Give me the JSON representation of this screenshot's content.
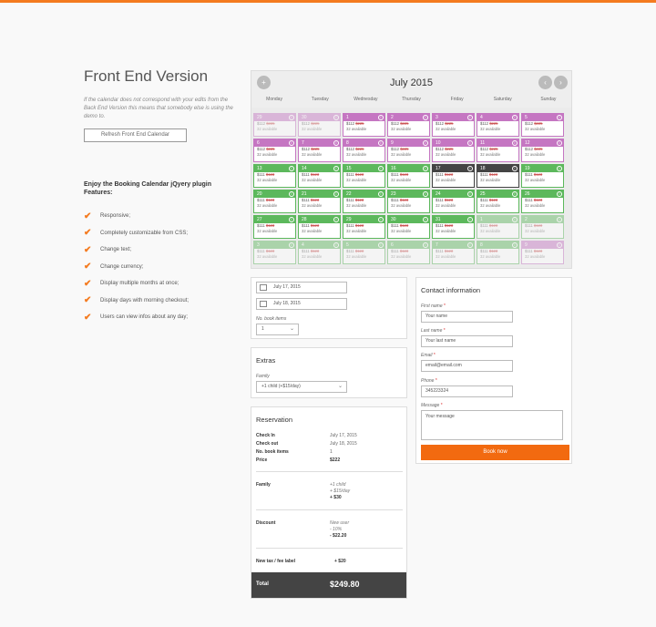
{
  "colors": {
    "accent": "#f47b20",
    "book_button": "#f26a10",
    "booked_purple": "#c576c2",
    "available_green": "#5cb85c",
    "selected_dark": "#444444"
  },
  "left": {
    "title": "Front End Version",
    "note": "If the calendar does not correspond with your edits from the Back End Version this means that somebody else is using the demo to.",
    "refresh_label": "Refresh Front End Calendar",
    "enjoy_heading": "Enjoy the Booking Calendar jQyery plugin Features:",
    "features": [
      "Responsive;",
      "Completely customizable from CSS;",
      "Change text;",
      "Change currency;",
      "Display multiple months at once;",
      "Display days with morning checkout;",
      "Users can view infos about any day;"
    ]
  },
  "calendar": {
    "month": "July 2015",
    "add_icon": "plus-circle-icon",
    "prev_icon": "chevron-left-icon",
    "next_icon": "chevron-right-icon",
    "weekdays": [
      "Monday",
      "Tuesday",
      "Wednesday",
      "Thursday",
      "Friday",
      "Saturday",
      "Sunday"
    ],
    "weeks": [
      [
        {
          "day": "29",
          "price": "$112",
          "old": "$225",
          "avail": "32 available",
          "status": "purple",
          "faded": true
        },
        {
          "day": "30",
          "price": "$112",
          "old": "$225",
          "avail": "32 available",
          "status": "purple",
          "faded": true
        },
        {
          "day": "1",
          "price": "$112",
          "old": "$225",
          "avail": "32 available",
          "status": "purple",
          "faded": false
        },
        {
          "day": "2",
          "price": "$112",
          "old": "$225",
          "avail": "32 available",
          "status": "purple",
          "faded": false
        },
        {
          "day": "3",
          "price": "$112",
          "old": "$225",
          "avail": "32 available",
          "status": "purple",
          "faded": false
        },
        {
          "day": "4",
          "price": "$112",
          "old": "$225",
          "avail": "32 available",
          "status": "purple",
          "faded": false
        },
        {
          "day": "5",
          "price": "$112",
          "old": "$225",
          "avail": "32 available",
          "status": "purple",
          "faded": false
        }
      ],
      [
        {
          "day": "6",
          "price": "$112",
          "old": "$225",
          "avail": "32 available",
          "status": "purple",
          "faded": false
        },
        {
          "day": "7",
          "price": "$112",
          "old": "$225",
          "avail": "32 available",
          "status": "purple",
          "faded": false
        },
        {
          "day": "8",
          "price": "$112",
          "old": "$225",
          "avail": "32 available",
          "status": "purple",
          "faded": false
        },
        {
          "day": "9",
          "price": "$112",
          "old": "$225",
          "avail": "32 available",
          "status": "purple",
          "faded": false
        },
        {
          "day": "10",
          "price": "$112",
          "old": "$225",
          "avail": "32 available",
          "status": "purple",
          "faded": false
        },
        {
          "day": "11",
          "price": "$112",
          "old": "$225",
          "avail": "32 available",
          "status": "purple",
          "faded": false
        },
        {
          "day": "12",
          "price": "$112",
          "old": "$225",
          "avail": "32 available",
          "status": "purple",
          "faded": false
        }
      ],
      [
        {
          "day": "13",
          "price": "$111",
          "old": "$123",
          "avail": "32 available",
          "status": "green",
          "faded": false
        },
        {
          "day": "14",
          "price": "$111",
          "old": "$123",
          "avail": "32 available",
          "status": "green",
          "faded": false
        },
        {
          "day": "15",
          "price": "$111",
          "old": "$123",
          "avail": "32 available",
          "status": "green",
          "faded": false
        },
        {
          "day": "16",
          "price": "$111",
          "old": "$123",
          "avail": "32 available",
          "status": "green",
          "faded": false
        },
        {
          "day": "17",
          "price": "$111",
          "old": "$123",
          "avail": "32 available",
          "status": "dark",
          "faded": false
        },
        {
          "day": "18",
          "price": "$111",
          "old": "$123",
          "avail": "32 available",
          "status": "dark",
          "faded": false
        },
        {
          "day": "19",
          "price": "$111",
          "old": "$123",
          "avail": "32 available",
          "status": "green",
          "faded": false
        }
      ],
      [
        {
          "day": "20",
          "price": "$111",
          "old": "$123",
          "avail": "32 available",
          "status": "green",
          "faded": false
        },
        {
          "day": "21",
          "price": "$111",
          "old": "$123",
          "avail": "32 available",
          "status": "green",
          "faded": false
        },
        {
          "day": "22",
          "price": "$111",
          "old": "$123",
          "avail": "32 available",
          "status": "green",
          "faded": false
        },
        {
          "day": "23",
          "price": "$111",
          "old": "$123",
          "avail": "32 available",
          "status": "green",
          "faded": false
        },
        {
          "day": "24",
          "price": "$111",
          "old": "$123",
          "avail": "32 available",
          "status": "green",
          "faded": false
        },
        {
          "day": "25",
          "price": "$111",
          "old": "$123",
          "avail": "32 available",
          "status": "green",
          "faded": false
        },
        {
          "day": "26",
          "price": "$111",
          "old": "$123",
          "avail": "32 available",
          "status": "green",
          "faded": false
        }
      ],
      [
        {
          "day": "27",
          "price": "$111",
          "old": "$123",
          "avail": "32 available",
          "status": "green",
          "faded": false
        },
        {
          "day": "28",
          "price": "$111",
          "old": "$123",
          "avail": "32 available",
          "status": "green",
          "faded": false
        },
        {
          "day": "29",
          "price": "$111",
          "old": "$123",
          "avail": "32 available",
          "status": "green",
          "faded": false
        },
        {
          "day": "30",
          "price": "$111",
          "old": "$123",
          "avail": "32 available",
          "status": "green",
          "faded": false
        },
        {
          "day": "31",
          "price": "$111",
          "old": "$123",
          "avail": "32 available",
          "status": "green",
          "faded": false
        },
        {
          "day": "1",
          "price": "$111",
          "old": "$123",
          "avail": "32 available",
          "status": "green",
          "faded": true
        },
        {
          "day": "2",
          "price": "$111",
          "old": "$123",
          "avail": "32 available",
          "status": "green",
          "faded": true
        }
      ],
      [
        {
          "day": "3",
          "price": "$111",
          "old": "$123",
          "avail": "32 available",
          "status": "green",
          "faded": true
        },
        {
          "day": "4",
          "price": "$111",
          "old": "$123",
          "avail": "32 available",
          "status": "green",
          "faded": true
        },
        {
          "day": "5",
          "price": "$111",
          "old": "$123",
          "avail": "32 available",
          "status": "green",
          "faded": true
        },
        {
          "day": "6",
          "price": "$111",
          "old": "$123",
          "avail": "32 available",
          "status": "green",
          "faded": true
        },
        {
          "day": "7",
          "price": "$111",
          "old": "$123",
          "avail": "32 available",
          "status": "green",
          "faded": true
        },
        {
          "day": "8",
          "price": "$111",
          "old": "$123",
          "avail": "32 available",
          "status": "green",
          "faded": true
        },
        {
          "day": "9",
          "price": "$111",
          "old": "$123",
          "avail": "32 available",
          "status": "purple",
          "faded": true
        }
      ]
    ]
  },
  "dates": {
    "check_in": "July 17, 2015",
    "check_out": "July 18, 2015",
    "items_label": "No. book items",
    "items_value": "1"
  },
  "extras": {
    "title": "Extras",
    "family_label": "Family",
    "family_value": "+1 child (+$15/day)"
  },
  "reservation": {
    "title": "Reservation",
    "check_in_label": "Check In",
    "check_in_value": "July 17, 2015",
    "check_out_label": "Check out",
    "check_out_value": "July 18, 2015",
    "items_label": "No. book items",
    "items_value": "1",
    "price_label": "Price",
    "price_value": "$222",
    "family_label": "Family",
    "family_lines": [
      "+1 child",
      "+ $15/day",
      "+ $30"
    ],
    "discount_label": "Discount",
    "discount_lines": [
      "New user",
      "- 10%",
      "- $22.20"
    ],
    "tax_label": "New tax / fee label",
    "tax_value": "+ $20",
    "total_label": "Total",
    "total_value": "$249.80"
  },
  "contact": {
    "title": "Contact information",
    "first_label": "First name",
    "first_placeholder": "Your name",
    "last_label": "Last name",
    "last_placeholder": "Your last name",
    "email_label": "Email",
    "email_placeholder": "email@email.com",
    "phone_label": "Phone",
    "phone_value": "345223324",
    "message_label": "Message",
    "message_placeholder": "Your message",
    "required_mark": "*",
    "book_label": "Book now"
  }
}
